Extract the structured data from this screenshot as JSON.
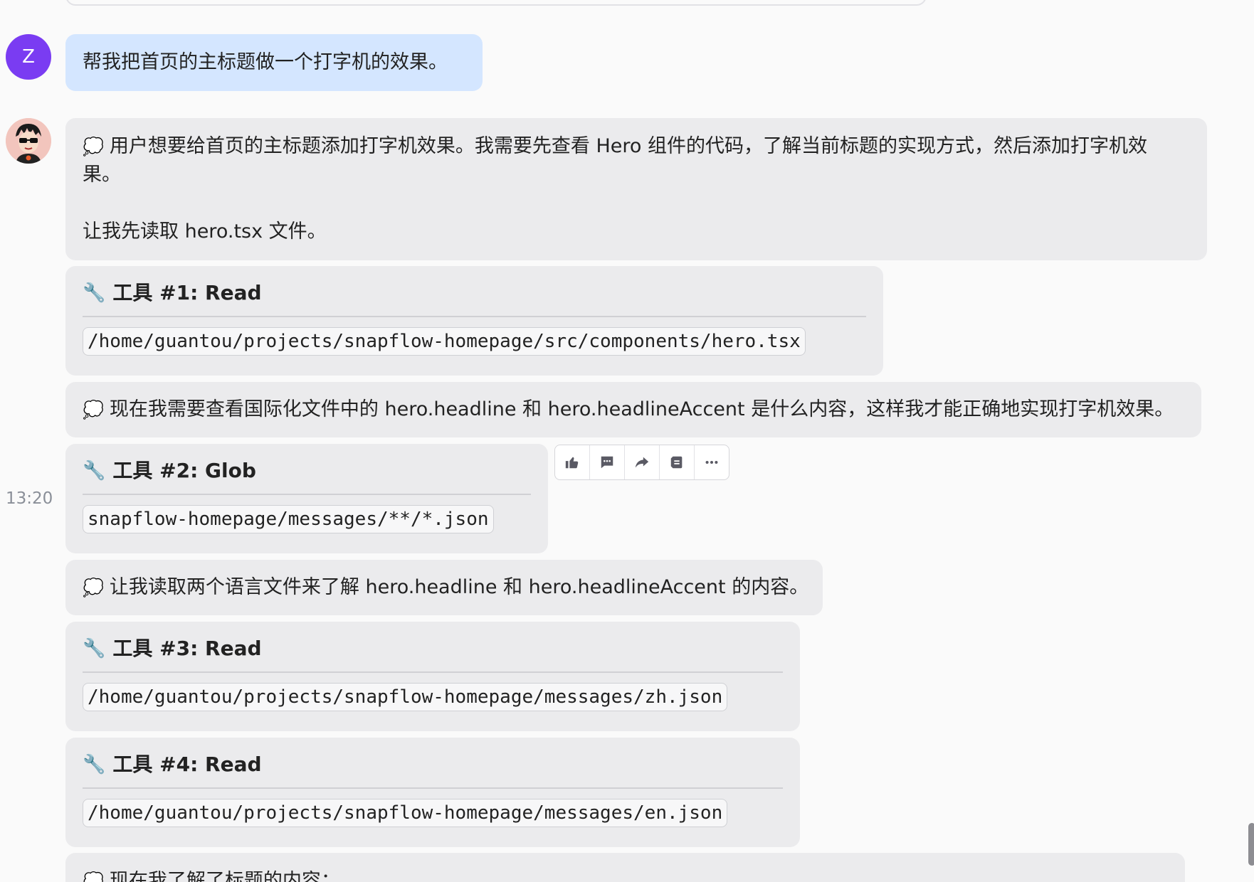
{
  "user": {
    "avatar_letter": "Z"
  },
  "timestamp": "13:20",
  "messages": {
    "user_prompt": "帮我把首页的主标题做一个打字机的效果。",
    "thought_1_line1": "用户想要给首页的主标题添加打字机效果。我需要先查看 Hero 组件的代码，了解当前标题的实现方式，然后添加打字机效",
    "thought_1_line2": "果。",
    "thought_1_line3": "让我先读取 hero.tsx 文件。",
    "thought_2": "现在我需要查看国际化文件中的 hero.headline 和 hero.headlineAccent 是什么内容，这样我才能正确地实现打字机效果。",
    "thought_3": "让我读取两个语言文件来了解 hero.headline 和 hero.headlineAccent 的内容。",
    "thought_4_partial": "现在我了解了标题的内容："
  },
  "tools": [
    {
      "title": "工具 #1: Read",
      "path": "/home/guantou/projects/snapflow-homepage/src/components/hero.tsx"
    },
    {
      "title": "工具 #2: Glob",
      "path": "snapflow-homepage/messages/**/*.json"
    },
    {
      "title": "工具 #3: Read",
      "path": "/home/guantou/projects/snapflow-homepage/messages/zh.json"
    },
    {
      "title": "工具 #4: Read",
      "path": "/home/guantou/projects/snapflow-homepage/messages/en.json"
    }
  ],
  "icons": {
    "wrench": "wrench-icon",
    "thought": "thought-bubble-icon",
    "thumbs_up": "thumbs-up-icon",
    "comment": "comment-icon",
    "share": "share-icon",
    "note": "note-icon",
    "more": "more-icon"
  },
  "colors": {
    "user_bubble": "#d4e6ff",
    "assistant_bubble": "#ebebed",
    "user_avatar": "#7a3cf2",
    "background": "#fafafa"
  }
}
